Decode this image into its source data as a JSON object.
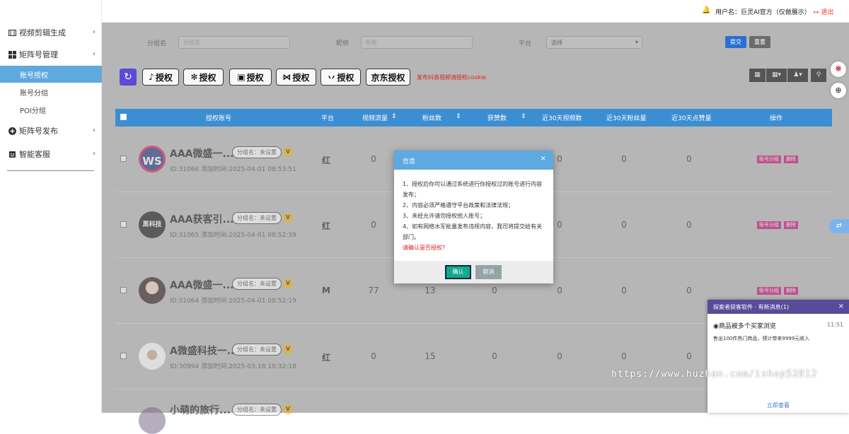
{
  "sidebar": {
    "video_gen": "视频剪辑生成",
    "matrix_mgmt": "矩阵号管理",
    "sub_items": [
      "账号授权",
      "账号分组",
      "POI分组"
    ],
    "matrix_publish": "矩阵号发布",
    "smart_service": "智能客服"
  },
  "topbar": {
    "user_label": "用户名：巨灵AI官方（仅做展示）",
    "logout": "退出"
  },
  "filters": {
    "group_label": "分组名",
    "group_placeholder": "分组名",
    "nickname_label": "昵称",
    "nickname_placeholder": "昵称",
    "platform_label": "平台",
    "platform_value": "选择",
    "submit": "提交",
    "reset": "重置"
  },
  "auth_buttons": [
    "授权",
    "授权",
    "授权",
    "授权",
    "授权",
    "京东授权"
  ],
  "cookie_note": "发布抖音视频请授权cookie",
  "table": {
    "headers": [
      "授权账号",
      "平台",
      "视频流量",
      "粉丝数",
      "获赞数",
      "近30天视频数",
      "近30天粉丝量",
      "近30天点赞量",
      "操作"
    ],
    "rows": [
      {
        "name": "AAA微盛一...",
        "group": "分组名：未设置",
        "verified": "V",
        "id_time": "ID:31066   添加时间:2025-04-01 08:53:51",
        "platform": "红",
        "views": "0",
        "fans": "",
        "likes": "",
        "v30": "0",
        "f30": "0",
        "l30": "0",
        "avatar": "WS"
      },
      {
        "name": "AAA获客引...",
        "group": "分组名：未设置",
        "verified": "V",
        "id_time": "ID:31065   添加时间:2025-04-01 08:52:39",
        "platform": "红",
        "views": "0",
        "fans": "",
        "likes": "",
        "v30": "0",
        "f30": "0",
        "l30": "0",
        "avatar": "黑科技"
      },
      {
        "name": "AAA微盛一...",
        "group": "分组名：未设置",
        "verified": "V",
        "id_time": "ID:31064   添加时间:2025-04-01 08:52:19",
        "platform": "M",
        "views": "77",
        "fans": "13",
        "likes": "0",
        "v30": "0",
        "f30": "0",
        "l30": "0",
        "avatar": ""
      },
      {
        "name": "A微盛科技一...",
        "group": "分组名：未设置",
        "verified": "V",
        "id_time": "ID:30994   添加时间:2025-03-18 10:32:18",
        "platform": "红",
        "views": "0",
        "fans": "15",
        "likes": "0",
        "v30": "0",
        "f30": "0",
        "l30": "0",
        "avatar": ""
      },
      {
        "name": "小萌的旅行...",
        "group": "分组名：未设置",
        "verified": "V",
        "id_time": "",
        "platform": "",
        "views": "",
        "fans": "",
        "likes": "",
        "v30": "",
        "f30": "",
        "l30": "",
        "avatar": ""
      }
    ],
    "op_group": "账号分组",
    "op_delete": "删除"
  },
  "dialog": {
    "title": "信息",
    "lines": [
      "1、授权后你可以通过系统进行你授权过的账号进行内容发布；",
      "2、内容必须严格遵守平台政策和法律法规；",
      "3、未经允许请勿授权他人账号；",
      "4、如有网络水军批量发布违规内容，我司将提交给有关部门。"
    ],
    "confirm_text": "请确认是否授权?",
    "ok": "确认",
    "cancel": "取消"
  },
  "notification": {
    "header": "探索者获客软件 · 有新消息(1)",
    "title": "商品被多个买家浏览",
    "time": "11:51",
    "text": "售出100件热门商品，预计带来9999元收入",
    "link": "立即查看"
  },
  "watermark": "https://www.huzhan.com/ishop52812",
  "colors": {
    "accent": "#5ea9e0",
    "table_header": "#3c8ed3",
    "op_button": "#c2006b",
    "notif_header": "#5a4a9a"
  }
}
